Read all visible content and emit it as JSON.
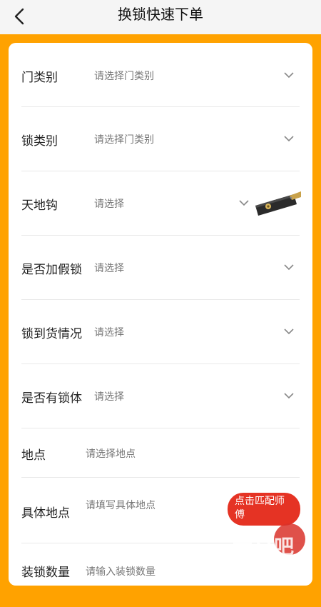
{
  "header": {
    "title": "换锁快速下单"
  },
  "form": {
    "rows": [
      {
        "label": "门类别",
        "value": "请选择门类别"
      },
      {
        "label": "锁类别",
        "value": "请选择门类别"
      },
      {
        "label": "天地钩",
        "value": "请选择"
      },
      {
        "label": "是否加假锁",
        "value": "请选择"
      },
      {
        "label": "锁到货情况",
        "value": "请选择"
      },
      {
        "label": "是否有锁体",
        "value": "请选择"
      },
      {
        "label": "地点",
        "value": "请选择地点"
      },
      {
        "label": "具体地点",
        "value": "请填写具体地点"
      },
      {
        "label": "装锁数量",
        "value": "请输入装锁数量"
      }
    ]
  },
  "fab": {
    "label": "点击匹配师傅"
  },
  "watermark": {
    "text": "素材吧",
    "url": "www.sucaibar.com"
  },
  "colors": {
    "accent": "#ffa200",
    "fab": "#e53324"
  }
}
